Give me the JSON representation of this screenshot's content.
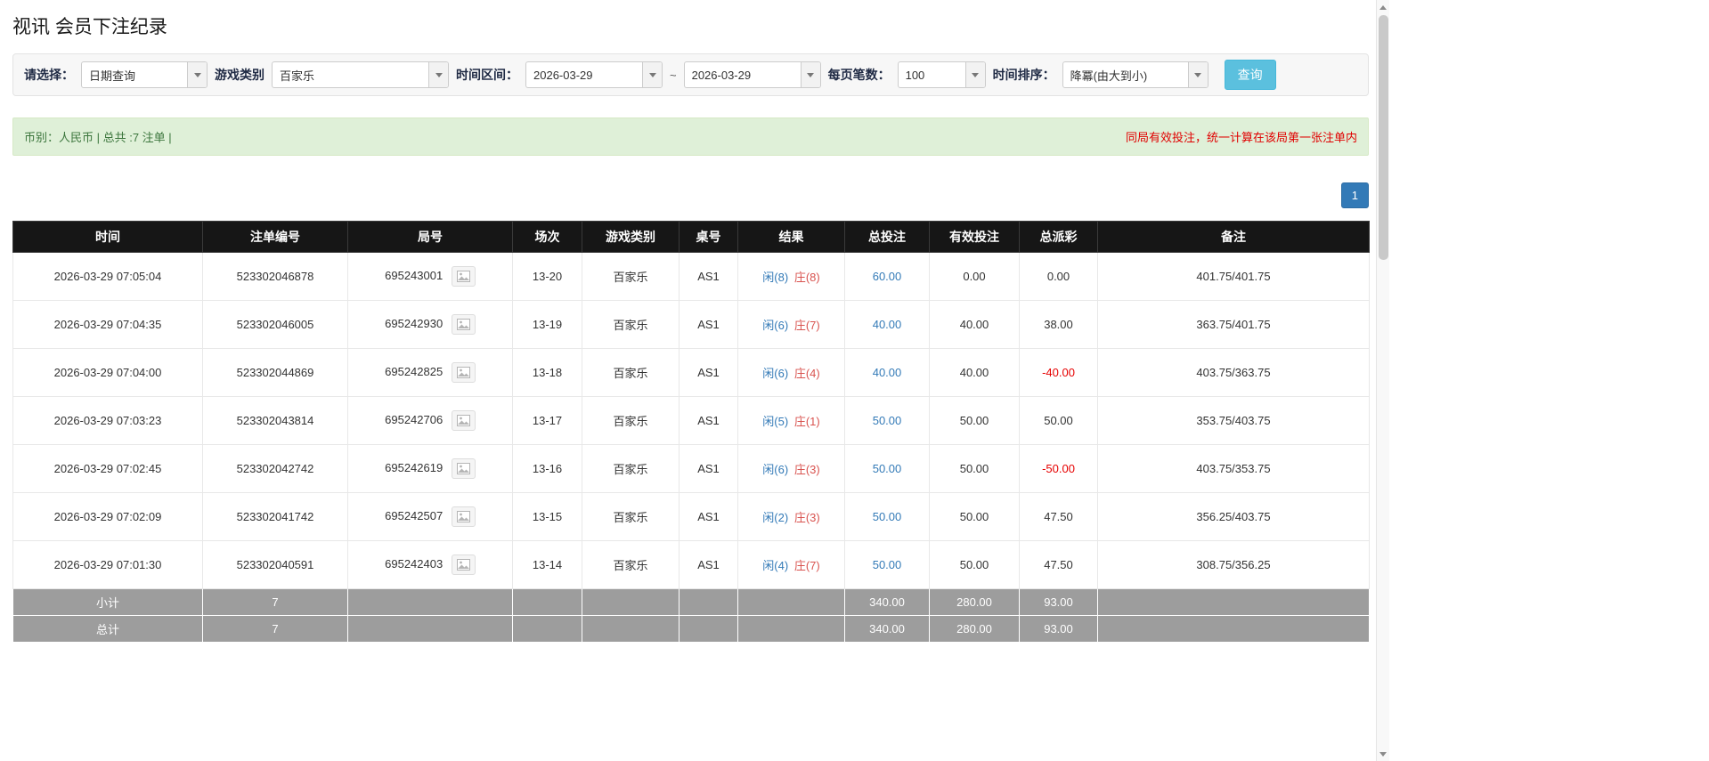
{
  "page_title": "视讯 会员下注纪录",
  "filters": {
    "select_label": "请选择：",
    "select_value": "日期查询",
    "game_type_label": "游戏类别",
    "game_type_value": "百家乐",
    "time_range_label": "时间区间：",
    "date_from": "2026-03-29",
    "range_separator": "~",
    "date_to": "2026-03-29",
    "page_size_label": "每页笔数：",
    "page_size_value": "100",
    "sort_label": "时间排序：",
    "sort_value": "降冪(由大到小)",
    "search_button_label": "查询"
  },
  "summary_bar": {
    "left_text": "币别：人民币 | 总共 :7 注单 |",
    "right_text": "同局有效投注，统一计算在该局第一张注单内"
  },
  "pagination": {
    "current_page": "1"
  },
  "table": {
    "headers": [
      "时间",
      "注单编号",
      "局号",
      "场次",
      "游戏类别",
      "桌号",
      "结果",
      "总投注",
      "有效投注",
      "总派彩",
      "备注"
    ],
    "rows": [
      {
        "time": "2026-03-29 07:05:04",
        "bet_id": "523302046878",
        "round_no": "695243001",
        "session": "13-20",
        "game": "百家乐",
        "table_no": "AS1",
        "result_player": "闲(8)",
        "result_banker": "庄(8)",
        "total_bet": "60.00",
        "valid_bet": "0.00",
        "payout": "0.00",
        "note": "401.75/401.75"
      },
      {
        "time": "2026-03-29 07:04:35",
        "bet_id": "523302046005",
        "round_no": "695242930",
        "session": "13-19",
        "game": "百家乐",
        "table_no": "AS1",
        "result_player": "闲(6)",
        "result_banker": "庄(7)",
        "total_bet": "40.00",
        "valid_bet": "40.00",
        "payout": "38.00",
        "note": "363.75/401.75"
      },
      {
        "time": "2026-03-29 07:04:00",
        "bet_id": "523302044869",
        "round_no": "695242825",
        "session": "13-18",
        "game": "百家乐",
        "table_no": "AS1",
        "result_player": "闲(6)",
        "result_banker": "庄(4)",
        "total_bet": "40.00",
        "valid_bet": "40.00",
        "payout": "-40.00",
        "note": "403.75/363.75"
      },
      {
        "time": "2026-03-29 07:03:23",
        "bet_id": "523302043814",
        "round_no": "695242706",
        "session": "13-17",
        "game": "百家乐",
        "table_no": "AS1",
        "result_player": "闲(5)",
        "result_banker": "庄(1)",
        "total_bet": "50.00",
        "valid_bet": "50.00",
        "payout": "50.00",
        "note": "353.75/403.75"
      },
      {
        "time": "2026-03-29 07:02:45",
        "bet_id": "523302042742",
        "round_no": "695242619",
        "session": "13-16",
        "game": "百家乐",
        "table_no": "AS1",
        "result_player": "闲(6)",
        "result_banker": "庄(3)",
        "total_bet": "50.00",
        "valid_bet": "50.00",
        "payout": "-50.00",
        "note": "403.75/353.75"
      },
      {
        "time": "2026-03-29 07:02:09",
        "bet_id": "523302041742",
        "round_no": "695242507",
        "session": "13-15",
        "game": "百家乐",
        "table_no": "AS1",
        "result_player": "闲(2)",
        "result_banker": "庄(3)",
        "total_bet": "50.00",
        "valid_bet": "50.00",
        "payout": "47.50",
        "note": "356.25/403.75"
      },
      {
        "time": "2026-03-29 07:01:30",
        "bet_id": "523302040591",
        "round_no": "695242403",
        "session": "13-14",
        "game": "百家乐",
        "table_no": "AS1",
        "result_player": "闲(4)",
        "result_banker": "庄(7)",
        "total_bet": "50.00",
        "valid_bet": "50.00",
        "payout": "47.50",
        "note": "308.75/356.25"
      }
    ],
    "subtotal_row": {
      "label": "小计",
      "bet_count": "7",
      "total_bet": "340.00",
      "valid_bet": "280.00",
      "payout": "93.00"
    },
    "total_row": {
      "label": "总计",
      "bet_count": "7",
      "total_bet": "340.00",
      "valid_bet": "280.00",
      "payout": "93.00"
    }
  },
  "icons": {
    "combo_arrow": "chevron-down",
    "round_media": "image-snapshot",
    "scroll_up": "triangle-up",
    "scroll_down": "triangle-down"
  },
  "colors": {
    "link_blue": "#337ab7",
    "player_blue": "#337ab7",
    "banker_red": "#d9534f",
    "negative_red": "#e60000",
    "search_button_blue": "#5bc0de",
    "header_black": "#161616",
    "footer_gray": "#9d9d9d",
    "summary_green_bg": "#dff0d8",
    "summary_text_green": "#3c763d",
    "notice_red": "#e00000",
    "pagination_blue": "#337ab7"
  }
}
